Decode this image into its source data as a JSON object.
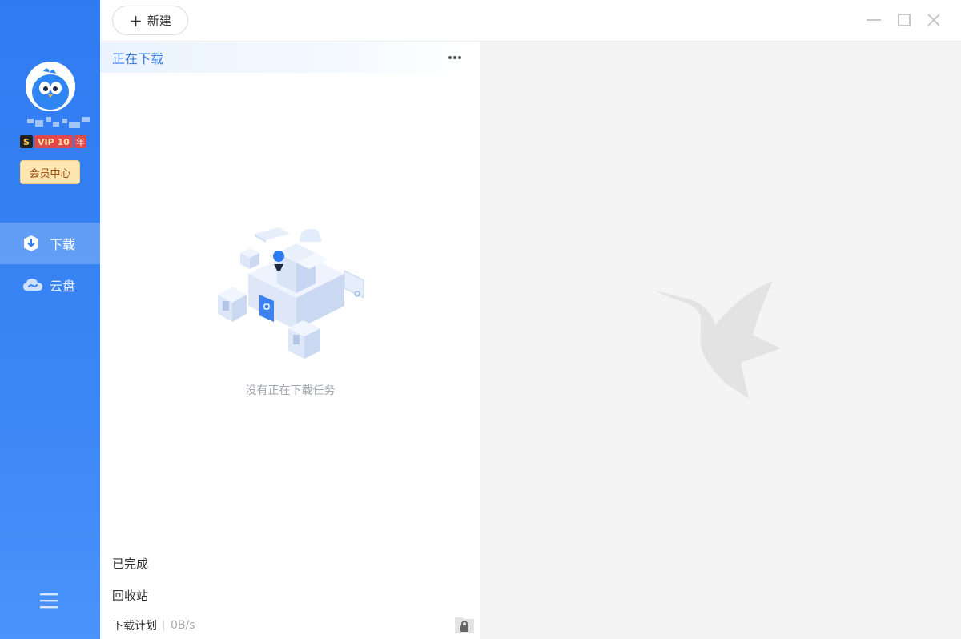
{
  "sidebar": {
    "vip": {
      "s": "S",
      "label": "VIP 10",
      "year": "年"
    },
    "member_center": "会员中心",
    "nav": [
      {
        "label": "下载",
        "icon": "download-shield-icon",
        "active": true
      },
      {
        "label": "云盘",
        "icon": "cloud-icon",
        "active": false
      }
    ],
    "menu_icon": "hamburger-menu-icon"
  },
  "toolbar": {
    "new_label": "新建",
    "window_controls": [
      "minimize-icon",
      "maximize-icon",
      "close-icon"
    ]
  },
  "downloads": {
    "section_title": "正在下载",
    "empty_text": "没有正在下载任务",
    "completed": "已完成",
    "recycle": "回收站",
    "plan": "下载计划",
    "speed": "0B/s"
  },
  "colors": {
    "sidebar": "#3a86f5",
    "accent": "#3a7be0",
    "member_bg": "#fde6b0",
    "vip_red": "#e0484b"
  }
}
